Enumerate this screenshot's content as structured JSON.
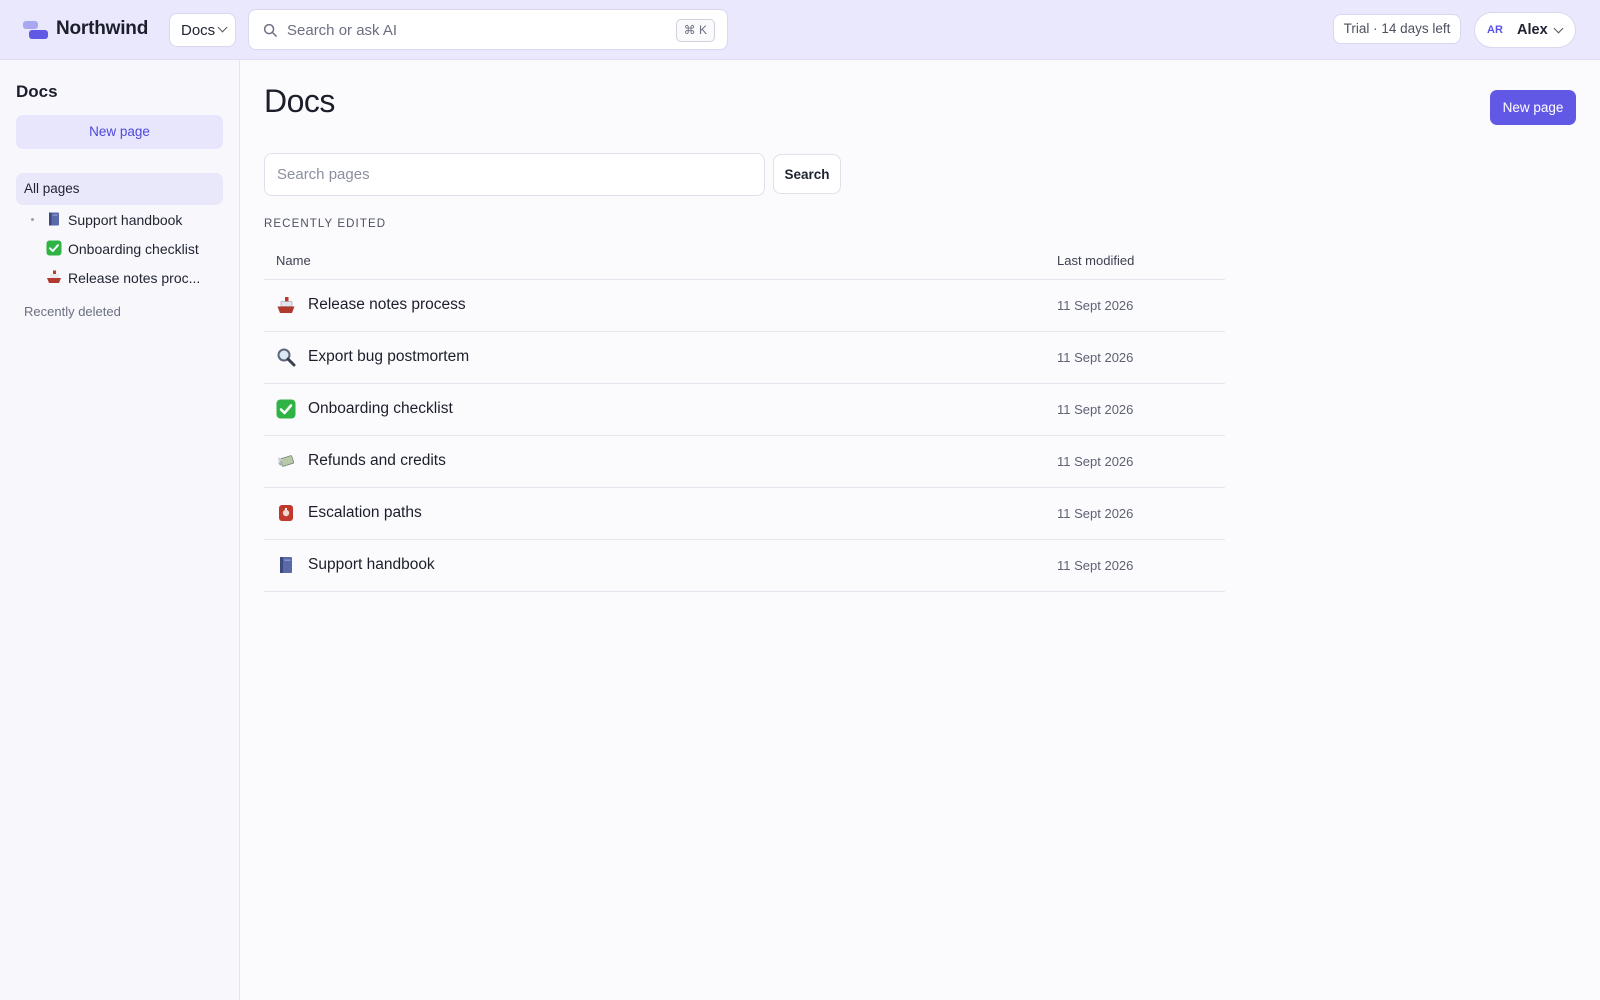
{
  "app": {
    "brand": "Northwind",
    "switcher_label": "Docs",
    "search_placeholder": "Search or ask AI",
    "search_shortcut": "⌘ K",
    "trial_text": "Trial · 14 days left",
    "user_initials": "AR",
    "user_name": "Alex"
  },
  "sidebar": {
    "title": "Docs",
    "new_page_label": "New page",
    "all_pages_label": "All pages",
    "items": [
      {
        "label": "Support handbook",
        "icon": "book-icon"
      },
      {
        "label": "Onboarding checklist",
        "icon": "checkmark-icon"
      },
      {
        "label": "Release notes proc...",
        "icon": "ship-icon"
      }
    ],
    "recently_deleted_label": "Recently deleted"
  },
  "main": {
    "title": "Docs",
    "new_page_label": "New page",
    "search_placeholder": "Search pages",
    "search_button_label": "Search",
    "section_label": "RECENTLY EDITED",
    "columns": {
      "name": "Name",
      "modified": "Last modified"
    },
    "rows": [
      {
        "name": "Release notes process",
        "icon": "ship-icon",
        "modified": "11 Sept 2026"
      },
      {
        "name": "Export bug postmortem",
        "icon": "magnifier-icon",
        "modified": "11 Sept 2026"
      },
      {
        "name": "Onboarding checklist",
        "icon": "checkmark-icon",
        "modified": "11 Sept 2026"
      },
      {
        "name": "Refunds and credits",
        "icon": "money-wings-icon",
        "modified": "11 Sept 2026"
      },
      {
        "name": "Escalation paths",
        "icon": "siren-icon",
        "modified": "11 Sept 2026"
      },
      {
        "name": "Support handbook",
        "icon": "book-icon",
        "modified": "11 Sept 2026"
      }
    ]
  },
  "colors": {
    "accent": "#6159e6",
    "topbar_bg": "#e9e8fd",
    "sidebar_bg": "#f7f7fc"
  }
}
